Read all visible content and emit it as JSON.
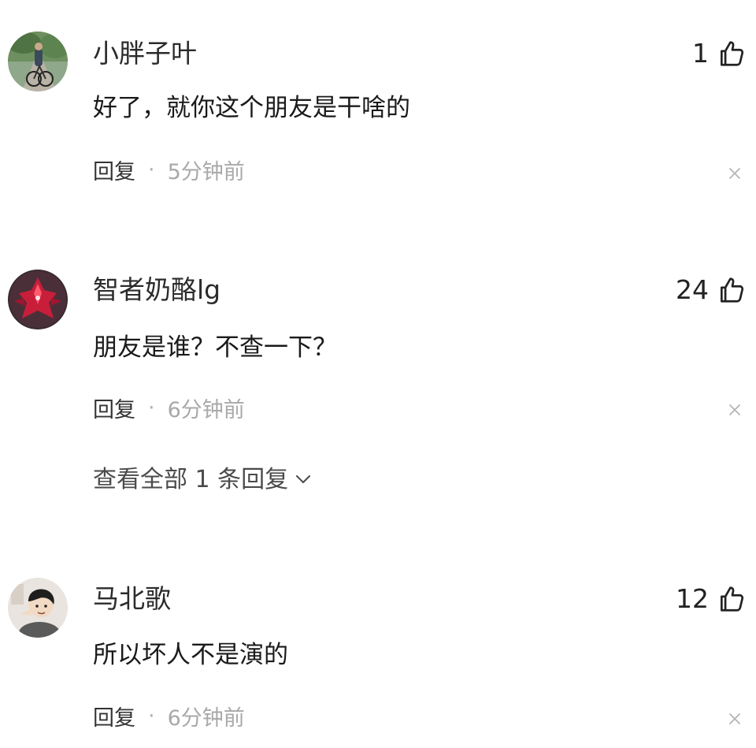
{
  "comments": [
    {
      "username": "小胖子叶",
      "likes": "1",
      "content": "好了，就你这个朋友是干啥的",
      "reply_label": "回复",
      "separator": "·",
      "time": "5分钟前",
      "avatar_icon": "avatar-cyclist-icon"
    },
    {
      "username": "智者奶酪lg",
      "likes": "24",
      "content": "朋友是谁？不查一下？",
      "reply_label": "回复",
      "separator": "·",
      "time": "6分钟前",
      "avatar_icon": "avatar-red-robot-icon",
      "view_replies": "查看全部 1 条回复"
    },
    {
      "username": "马北歌",
      "likes": "12",
      "content": "所以坏人不是演的",
      "reply_label": "回复",
      "separator": "·",
      "time": "6分钟前",
      "avatar_icon": "avatar-cartoon-boy-icon"
    }
  ],
  "icons": {
    "like": "thumbs-up-icon",
    "dismiss": "close-icon",
    "expand": "chevron-down-icon"
  },
  "colors": {
    "text_primary": "#222222",
    "text_secondary": "#a9a9a9",
    "background": "#ffffff"
  }
}
